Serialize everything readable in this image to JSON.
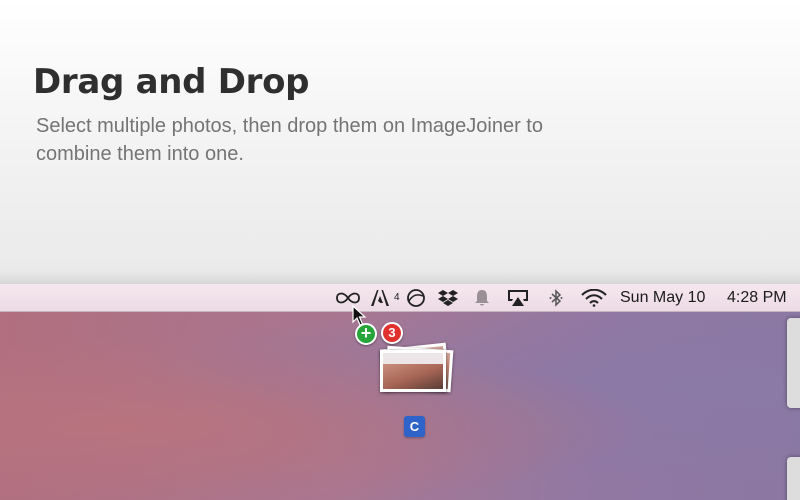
{
  "header": {
    "title": "Drag and Drop",
    "subtitle": "Select multiple photos, then drop them on ImageJoiner to combine them into one."
  },
  "menubar": {
    "icons": [
      "infinity-icon",
      "adobe-icon",
      "activity-icon",
      "dropbox-icon",
      "notification-bell-icon",
      "airplay-icon",
      "bluetooth-icon",
      "wifi-icon"
    ],
    "adobe_sub": "4",
    "date": "Sun May 10",
    "time": "4:28 PM"
  },
  "drag": {
    "add_symbol": "+",
    "count": "3",
    "app_icon_letter": "C"
  },
  "colors": {
    "add_badge": "#27a53a",
    "count_badge": "#e0312f",
    "app_icon": "#2e63c9"
  }
}
